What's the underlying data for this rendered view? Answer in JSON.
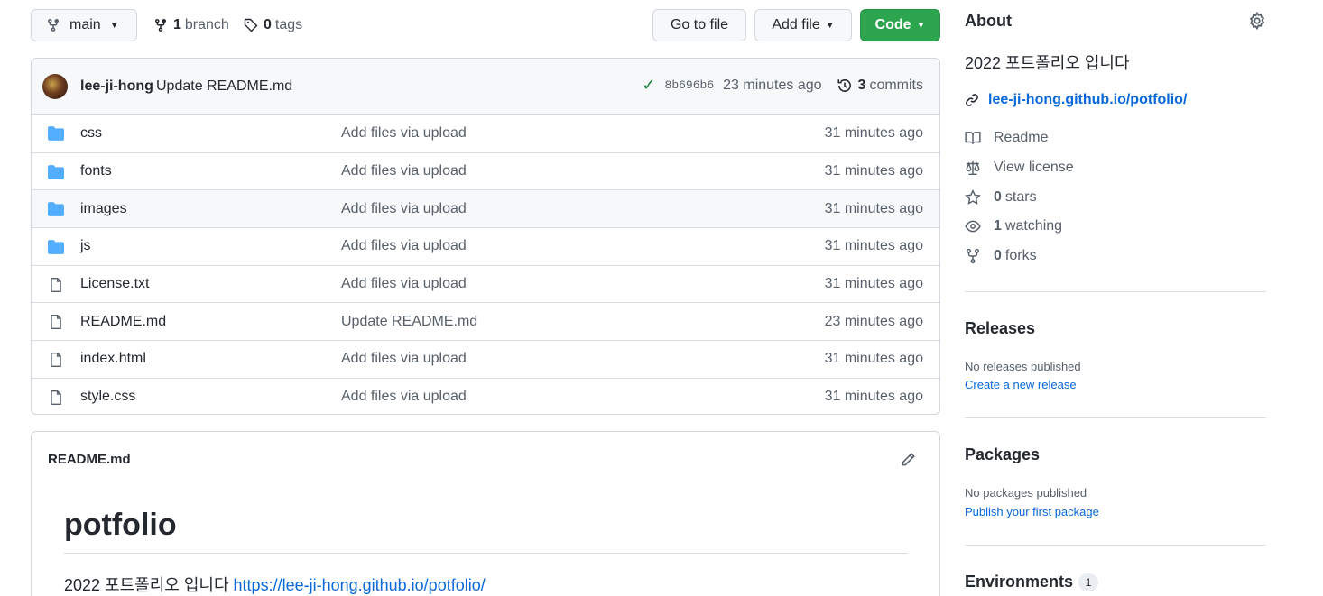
{
  "toolbar": {
    "branch_name": "main",
    "branches_count": "1",
    "branches_label": "branch",
    "tags_count": "0",
    "tags_label": "tags",
    "go_to_file": "Go to file",
    "add_file": "Add file",
    "code": "Code"
  },
  "commit": {
    "author": "lee-ji-hong",
    "message": "Update README.md",
    "sha": "8b696b6",
    "time": "23 minutes ago",
    "commits_count": "3",
    "commits_label": "commits"
  },
  "files": [
    {
      "name": "css",
      "type": "folder",
      "message": "Add files via upload",
      "age": "31 minutes ago"
    },
    {
      "name": "fonts",
      "type": "folder",
      "message": "Add files via upload",
      "age": "31 minutes ago"
    },
    {
      "name": "images",
      "type": "folder",
      "message": "Add files via upload",
      "age": "31 minutes ago"
    },
    {
      "name": "js",
      "type": "folder",
      "message": "Add files via upload",
      "age": "31 minutes ago"
    },
    {
      "name": "License.txt",
      "type": "file",
      "message": "Add files via upload",
      "age": "31 minutes ago"
    },
    {
      "name": "README.md",
      "type": "file",
      "message": "Update README.md",
      "age": "23 minutes ago"
    },
    {
      "name": "index.html",
      "type": "file",
      "message": "Add files via upload",
      "age": "31 minutes ago"
    },
    {
      "name": "style.css",
      "type": "file",
      "message": "Add files via upload",
      "age": "31 minutes ago"
    }
  ],
  "readme": {
    "filename": "README.md",
    "title": "potfolio",
    "text": "2022 포트폴리오 입니다",
    "link": "https://lee-ji-hong.github.io/potfolio/"
  },
  "about": {
    "heading": "About",
    "description": "2022 포트폴리오 입니다",
    "website": "lee-ji-hong.github.io/potfolio/",
    "readme": "Readme",
    "license": "View license",
    "stars_count": "0",
    "stars_label": "stars",
    "watching_count": "1",
    "watching_label": "watching",
    "forks_count": "0",
    "forks_label": "forks"
  },
  "releases": {
    "heading": "Releases",
    "none": "No releases published",
    "create": "Create a new release"
  },
  "packages": {
    "heading": "Packages",
    "none": "No packages published",
    "publish": "Publish your first package"
  },
  "environments": {
    "heading": "Environments",
    "count": "1"
  },
  "colors": {
    "accent_link": "#0969da",
    "code_button": "#2da44e",
    "folder_icon": "#54aeff",
    "check": "#1a7f37"
  }
}
